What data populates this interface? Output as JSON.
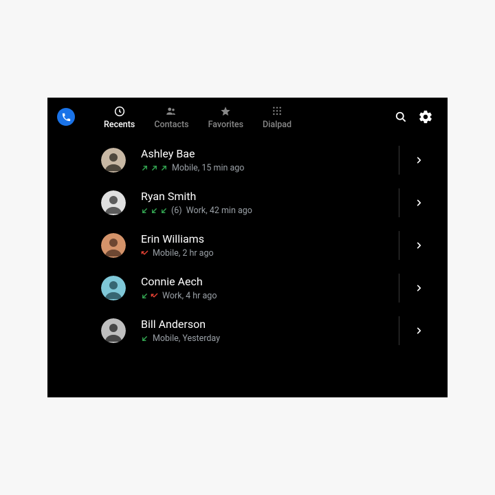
{
  "app_icon": "phone",
  "tabs": [
    {
      "id": "recents",
      "label": "Recents",
      "icon": "clock",
      "active": true
    },
    {
      "id": "contacts",
      "label": "Contacts",
      "icon": "people",
      "active": false
    },
    {
      "id": "favorites",
      "label": "Favorites",
      "icon": "star",
      "active": false
    },
    {
      "id": "dialpad",
      "label": "Dialpad",
      "icon": "dialpad",
      "active": false
    }
  ],
  "actions": {
    "search_icon": "search",
    "settings_icon": "gear"
  },
  "calls": [
    {
      "name": "Ashley Bae",
      "arrows": [
        "out-green",
        "out-green",
        "out-green"
      ],
      "count": "",
      "meta": "Mobile, 15 min ago",
      "avatar": {
        "bg": "#c8b8a4",
        "fg": "#3a342c"
      }
    },
    {
      "name": "Ryan Smith",
      "arrows": [
        "in-green",
        "in-green",
        "in-green"
      ],
      "count": "(6)",
      "meta": "Work, 42 min ago",
      "avatar": {
        "bg": "#e0e0e0",
        "fg": "#444"
      }
    },
    {
      "name": "Erin Williams",
      "arrows": [
        "missed-red"
      ],
      "count": "",
      "meta": "Mobile, 2 hr ago",
      "avatar": {
        "bg": "#d4936a",
        "fg": "#5a3a28"
      }
    },
    {
      "name": "Connie Aech",
      "arrows": [
        "in-green",
        "missed-red"
      ],
      "count": "",
      "meta": "Work, 4 hr ago",
      "avatar": {
        "bg": "#7fc8d8",
        "fg": "#2a5560"
      }
    },
    {
      "name": "Bill Anderson",
      "arrows": [
        "in-green"
      ],
      "count": "",
      "meta": "Mobile, Yesterday",
      "avatar": {
        "bg": "#bfbfbf",
        "fg": "#333"
      }
    }
  ],
  "colors": {
    "arrow_green": "#34a853",
    "arrow_red": "#ea4335"
  }
}
